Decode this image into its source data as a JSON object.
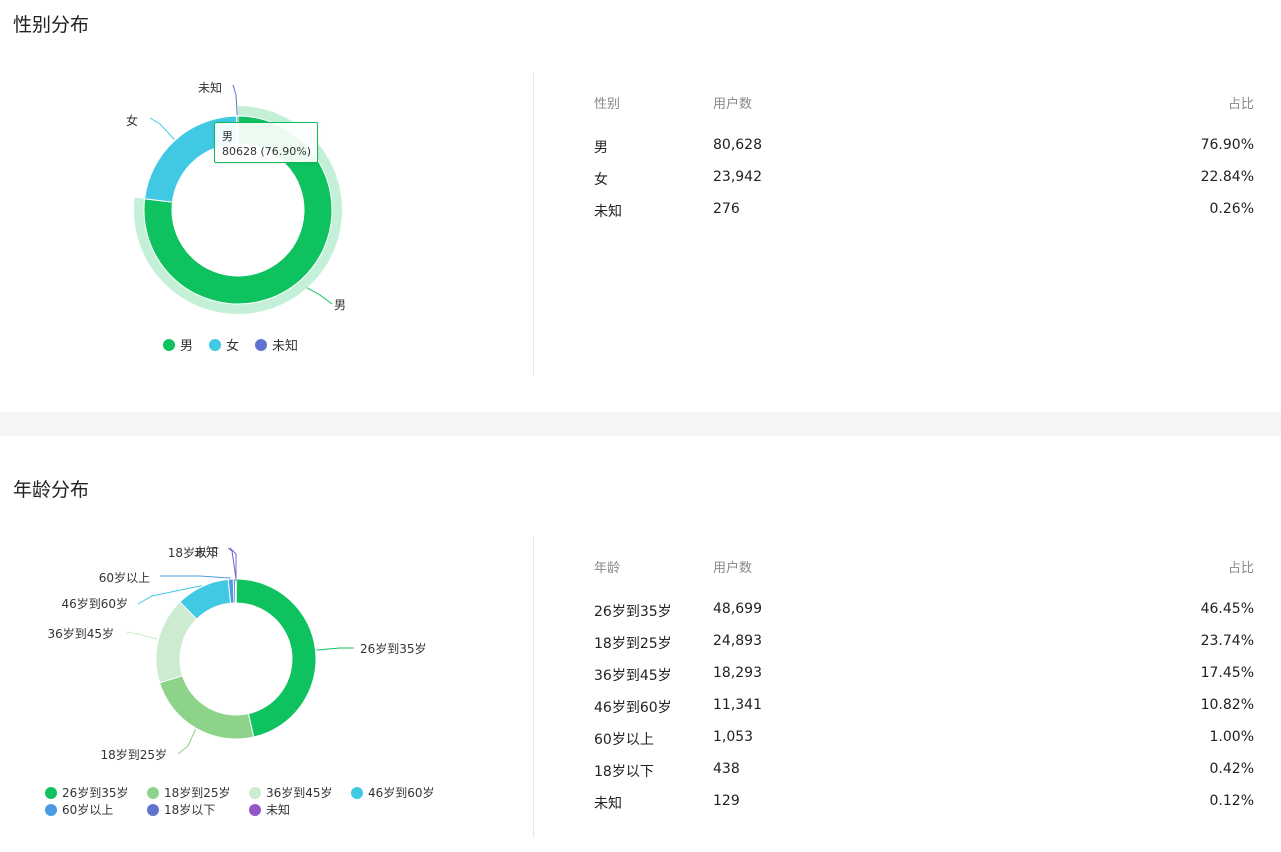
{
  "gender": {
    "title": "性别分布",
    "tooltip": {
      "name": "男",
      "value_text": "80628 (76.90%)"
    },
    "table_headers": [
      "性别",
      "用户数",
      "占比"
    ],
    "rows": [
      {
        "label": "男",
        "count": "80,628",
        "pct": "76.90%"
      },
      {
        "label": "女",
        "count": "23,942",
        "pct": "22.84%"
      },
      {
        "label": "未知",
        "count": "276",
        "pct": "0.26%"
      }
    ],
    "legend": [
      {
        "label": "男",
        "color": "#0ec35f"
      },
      {
        "label": "女",
        "color": "#41c8e2"
      },
      {
        "label": "未知",
        "color": "#6173cf"
      }
    ]
  },
  "age": {
    "title": "年龄分布",
    "table_headers": [
      "年龄",
      "用户数",
      "占比"
    ],
    "rows": [
      {
        "label": "26岁到35岁",
        "count": "48,699",
        "pct": "46.45%"
      },
      {
        "label": "18岁到25岁",
        "count": "24,893",
        "pct": "23.74%"
      },
      {
        "label": "36岁到45岁",
        "count": "18,293",
        "pct": "17.45%"
      },
      {
        "label": "46岁到60岁",
        "count": "11,341",
        "pct": "10.82%"
      },
      {
        "label": "60岁以上",
        "count": "1,053",
        "pct": "1.00%"
      },
      {
        "label": "18岁以下",
        "count": "438",
        "pct": "0.42%"
      },
      {
        "label": "未知",
        "count": "129",
        "pct": "0.12%"
      }
    ],
    "legend": [
      {
        "label": "26岁到35岁",
        "color": "#0ec35f"
      },
      {
        "label": "18岁到25岁",
        "color": "#8dd38a"
      },
      {
        "label": "36岁到45岁",
        "color": "#cdeccf"
      },
      {
        "label": "46岁到60岁",
        "color": "#41c8e2"
      },
      {
        "label": "60岁以上",
        "color": "#4a9be4"
      },
      {
        "label": "18岁以下",
        "color": "#6173cf"
      },
      {
        "label": "未知",
        "color": "#9256c9"
      }
    ]
  },
  "chart_data": [
    {
      "type": "pie",
      "title": "性别分布",
      "categories": [
        "男",
        "女",
        "未知"
      ],
      "values": [
        80628,
        23942,
        276
      ],
      "percentages": [
        76.9,
        22.84,
        0.26
      ],
      "colors": [
        "#0ec35f",
        "#41c8e2",
        "#6173cf"
      ],
      "highlighted": "男",
      "legend": "bottom"
    },
    {
      "type": "pie",
      "title": "年龄分布",
      "categories": [
        "26岁到35岁",
        "18岁到25岁",
        "36岁到45岁",
        "46岁到60岁",
        "60岁以上",
        "18岁以下",
        "未知"
      ],
      "values": [
        48699,
        24893,
        18293,
        11341,
        1053,
        438,
        129
      ],
      "percentages": [
        46.45,
        23.74,
        17.45,
        10.82,
        1.0,
        0.42,
        0.12
      ],
      "colors": [
        "#0ec35f",
        "#8dd38a",
        "#cdeccf",
        "#41c8e2",
        "#4a9be4",
        "#6173cf",
        "#9256c9"
      ],
      "legend": "bottom"
    }
  ]
}
